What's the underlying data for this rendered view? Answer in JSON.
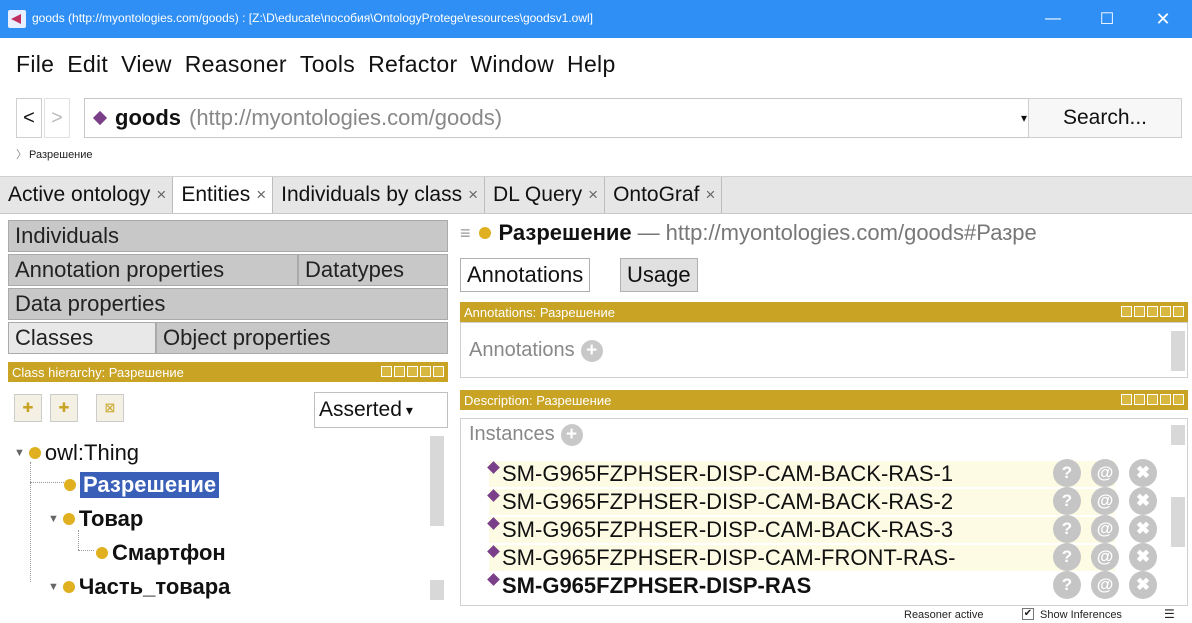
{
  "window": {
    "title": "goods (http://myontologies.com/goods) : [Z:\\D\\educate\\пособия\\OntologyProtege\\resources\\goodsv1.owl]",
    "minimize": "—",
    "maximize": "☐",
    "close": "✕"
  },
  "menu": [
    "File",
    "Edit",
    "View",
    "Reasoner",
    "Tools",
    "Refactor",
    "Window",
    "Help"
  ],
  "address": {
    "back": "<",
    "forward": ">",
    "name": "goods",
    "iri": "(http://myontologies.com/goods)",
    "dropdown": "▾",
    "search": "Search...",
    "breadcrumb": "Разрешение"
  },
  "main_tabs": [
    {
      "label": "Active ontology",
      "close": "×"
    },
    {
      "label": "Entities",
      "close": "×"
    },
    {
      "label": "Individuals by class",
      "close": "×"
    },
    {
      "label": "DL Query",
      "close": "×"
    },
    {
      "label": "OntoGraf",
      "close": "×"
    }
  ],
  "left_tabs": {
    "individuals": "Individuals",
    "annotation_properties": "Annotation properties",
    "datatypes": "Datatypes",
    "data_properties": "Data properties",
    "classes": "Classes",
    "object_properties": "Object properties"
  },
  "class_hierarchy": {
    "header": "Class hierarchy: Разрешение",
    "mode": "Asserted",
    "mode_arrow": "▾",
    "tree": {
      "root": "owl:Thing",
      "n1": "Разрешение",
      "n2": "Товар",
      "n3": "Смартфон",
      "n4": "Часть_товара"
    },
    "twisty_expanded": "▼"
  },
  "entity": {
    "menu": "≡",
    "name": "Разрешение",
    "dash": "—",
    "iri": "http://myontologies.com/goods#Разре",
    "tabs": [
      "Annotations",
      "Usage"
    ]
  },
  "annotations": {
    "header": "Annotations: Разрешение",
    "label": "Annotations",
    "plus": "+"
  },
  "description": {
    "header": "Description: Разрешение",
    "label": "Instances",
    "plus": "+",
    "instances": [
      "SM-G965FZPHSER-DISP-CAM-BACK-RAS-1",
      "SM-G965FZPHSER-DISP-CAM-BACK-RAS-2",
      "SM-G965FZPHSER-DISP-CAM-BACK-RAS-3",
      "SM-G965FZPHSER-DISP-CAM-FRONT-RAS-",
      "SM-G965FZPHSER-DISP-RAS"
    ],
    "action_help": "?",
    "action_at": "@",
    "action_delete": "✖"
  },
  "status": {
    "reasoner": "Reasoner active",
    "check": "✔",
    "show_inferences": "Show Inferences",
    "icon": "☰"
  },
  "colors": {
    "titlebar": "#2f8ff5",
    "section_header": "#c9a323",
    "class_dot": "#e0b020",
    "individual_diamond": "#7a3f88",
    "selection": "#3a5fb8"
  }
}
